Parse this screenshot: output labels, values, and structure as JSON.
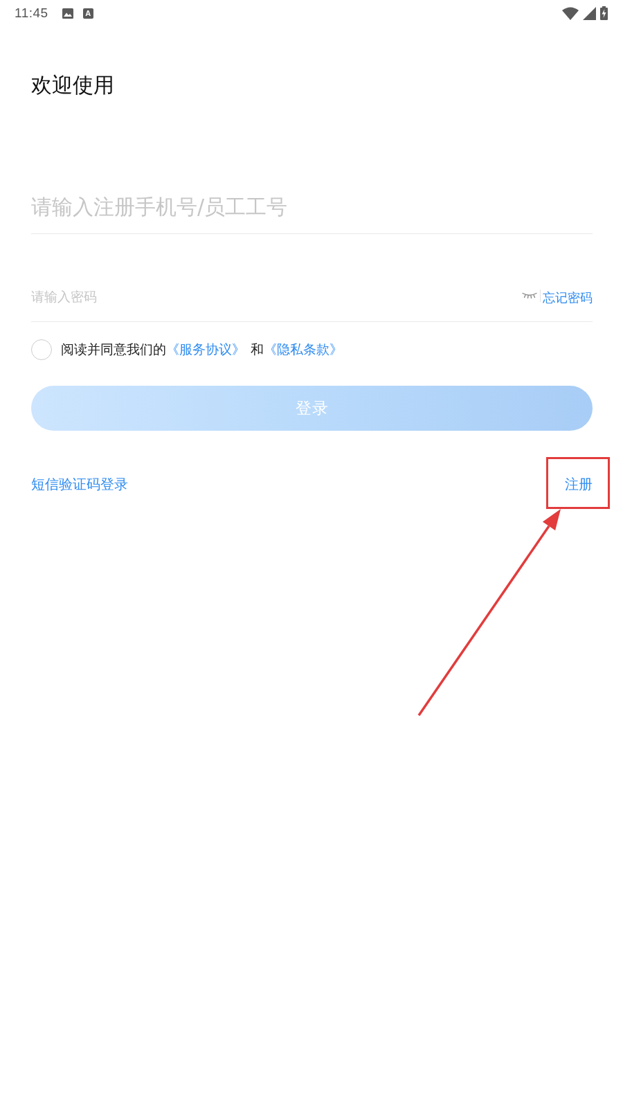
{
  "status_bar": {
    "time": "11:45",
    "notification_letter": "A"
  },
  "title": "欢迎使用",
  "phone_field": {
    "placeholder": "请输入注册手机号/员工工号"
  },
  "password_field": {
    "placeholder": "请输入密码",
    "forgot_link": "忘记密码"
  },
  "agreement": {
    "checked": false,
    "text": "阅读并同意我们的",
    "service_link": "《服务协议》",
    "joiner": "和",
    "privacy_link": "《隐私条款》"
  },
  "login_button": {
    "label": "登录",
    "disabled": true
  },
  "links": [
    {
      "label": "短信验证码登录",
      "highlighted": false
    },
    {
      "label": "注册",
      "highlighted": true
    }
  ]
}
